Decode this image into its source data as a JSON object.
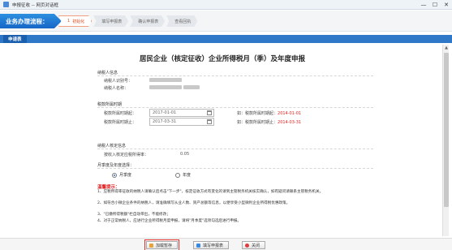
{
  "window": {
    "title": "申报征收 -- 网页对话框",
    "min": "—",
    "max": "☐",
    "close": "✕"
  },
  "process": {
    "label": "业务办理流程：",
    "steps": [
      {
        "num": "1",
        "label": "初始化",
        "active": true
      },
      {
        "num": "",
        "label": "填写申报表",
        "active": false
      },
      {
        "num": "",
        "label": "确认申报表",
        "active": false
      },
      {
        "num": "",
        "label": "查看回执",
        "active": false
      }
    ]
  },
  "section_tab": "申请表",
  "form": {
    "title": "居民企业（核定征收）企业所得税月（季）及年度申报",
    "taxpayer_group": "纳税人信息",
    "taxpayer_id_label": "纳税人识别号：",
    "taxpayer_name_label": "纳税人名称：",
    "period_group": "税款所属时期",
    "period_start_label": "税款所属时期起：",
    "period_start_value": "2017-01-01",
    "period_end_label": "税款所属时期止：",
    "period_end_value": "2017-03-31",
    "hint_start_prefix": "如：税款所属时期起：",
    "hint_start_value": "2014-01-01",
    "hint_end_prefix": "如：税款所属时期止：",
    "hint_end_value": "2014-03-31",
    "approval_group": "纳税人核定信息",
    "rate_label": "按收入核定应税所得率：",
    "rate_value": "0.05",
    "option_group": "月季度及年度选择：",
    "option_quarter": "月季度",
    "option_year": "年度",
    "option_selected": "月季度"
  },
  "warnings": {
    "title": "温馨提示：",
    "lines": [
      "1、应税所得率征收的纳税人请确认后点击\"下一步\"，核定征收方式有变化的请到主管税务机关核实确认，如有疑问请联系主管税务机关。",
      "2、如符合小微企业条件的纳税人，请准确填写从业人数、资产总额等信息，以便享受小型微利企业所得税优惠政策。",
      "3、\"已缴所得税额\"栏自动带出，不能修改；",
      "4、对于正常纳税人，应进行企业所得税月度申报，请将\"月季度\"选项勾选后进行申报。"
    ]
  },
  "buttons": {
    "save": "加载暂存",
    "fill": "填写申报表",
    "close": "关闭"
  }
}
